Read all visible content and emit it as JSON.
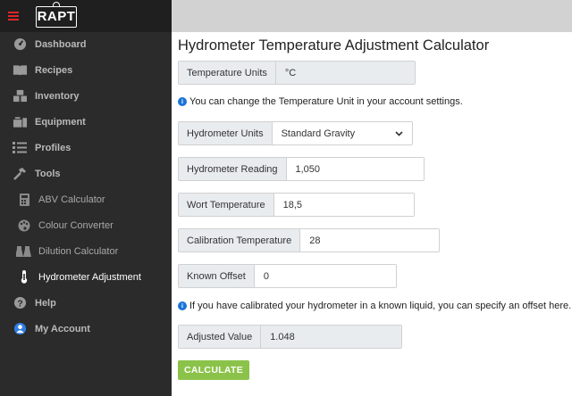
{
  "logo_text": "RAPT",
  "nav": {
    "dashboard": "Dashboard",
    "recipes": "Recipes",
    "inventory": "Inventory",
    "equipment": "Equipment",
    "profiles": "Profiles",
    "tools": "Tools",
    "abv": "ABV Calculator",
    "colour": "Colour Converter",
    "dilution": "Dilution Calculator",
    "hydrometer": "Hydrometer Adjustment",
    "help": "Help",
    "account": "My Account"
  },
  "page": {
    "title": "Hydrometer Temperature Adjustment Calculator",
    "temp_units_label": "Temperature Units",
    "temp_units_value": "°C",
    "temp_info": "You can change the Temperature Unit in your account settings.",
    "hydro_units_label": "Hydrometer Units",
    "hydro_units_value": "Standard Gravity",
    "reading_label": "Hydrometer Reading",
    "reading_value": "1,050",
    "wort_label": "Wort Temperature",
    "wort_value": "18,5",
    "calib_label": "Calibration Temperature",
    "calib_value": "28",
    "offset_label": "Known Offset",
    "offset_value": "0",
    "offset_info": "If you have calibrated your hydrometer in a known liquid, you can specify an offset here.",
    "adjusted_label": "Adjusted Value",
    "adjusted_value": "1.048",
    "calc_button": "CALCULATE"
  },
  "colors": {
    "accent": "#8bc34a",
    "sidebar": "#2b2b2b",
    "info": "#1a73d9",
    "hamburger": "#e0242a"
  }
}
